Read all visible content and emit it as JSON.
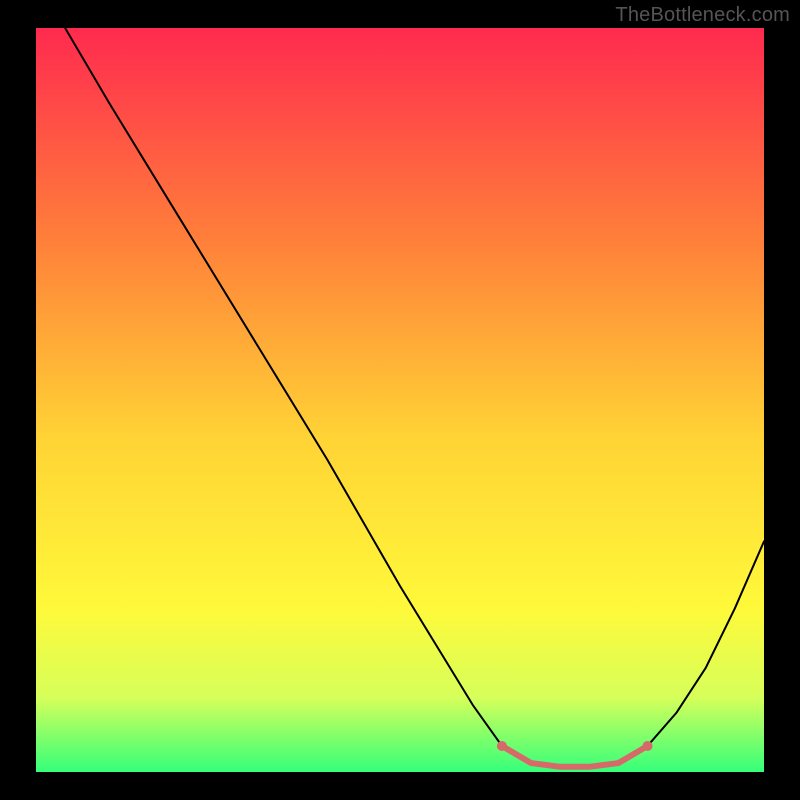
{
  "watermark": "TheBottleneck.com",
  "chart_data": {
    "type": "line",
    "title": "",
    "xlabel": "",
    "ylabel": "",
    "xlim": [
      0,
      100
    ],
    "ylim": [
      0,
      100
    ],
    "grid": false,
    "legend": false,
    "background_gradient": {
      "top": "#ff2a4f",
      "mid1": "#ff7e3a",
      "mid2": "#ffd335",
      "mid3": "#fff93a",
      "mid4": "#d6ff5a",
      "bottom": "#34ff7a"
    },
    "series": [
      {
        "name": "bottleneck-curve",
        "stroke": "#000000",
        "stroke_width": 2.0,
        "x": [
          4,
          10,
          20,
          30,
          40,
          50,
          55,
          60,
          64,
          68,
          72,
          76,
          80,
          84,
          88,
          92,
          96,
          100
        ],
        "values": [
          100,
          90,
          74,
          58,
          42,
          25,
          17,
          9,
          3.5,
          1.2,
          0.7,
          0.7,
          1.2,
          3.5,
          8,
          14,
          22,
          31
        ]
      }
    ],
    "highlight_band": {
      "name": "optimal-range",
      "color": "#d66a6a",
      "stroke_width": 6,
      "x": [
        64,
        68,
        72,
        76,
        80,
        84
      ],
      "values": [
        3.5,
        1.2,
        0.7,
        0.7,
        1.2,
        3.5
      ],
      "end_dots": true
    }
  }
}
